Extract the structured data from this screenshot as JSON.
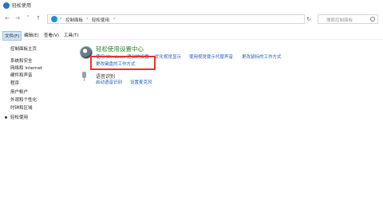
{
  "window": {
    "title": "轻松使用"
  },
  "address_bar": {
    "breadcrumbs": [
      "控制面板",
      "轻松使用"
    ],
    "search_placeholder": "搜索控制面板"
  },
  "menu": {
    "items": [
      "文件(F)",
      "编辑(E)",
      "查看(V)",
      "工具(T)"
    ]
  },
  "sidebar": {
    "items": [
      "控制面板主页",
      "系统和安全",
      "网络和 Internet",
      "硬件和声音",
      "程序",
      "用户帐户",
      "外观和个性化",
      "时钟和区域",
      "轻松使用"
    ]
  },
  "main": {
    "section1": {
      "title": "轻松使用设置中心",
      "links_row1": [
        "使用 Windows 建议的设置",
        "优化视觉显示",
        "使用视觉提示代替声音",
        "更改鼠标的工作方式"
      ],
      "links_row2": [
        "更改键盘的工作方式"
      ]
    },
    "section2": {
      "title": "语音识别",
      "links": [
        "启动语音识别",
        "设置麦克风"
      ]
    }
  }
}
